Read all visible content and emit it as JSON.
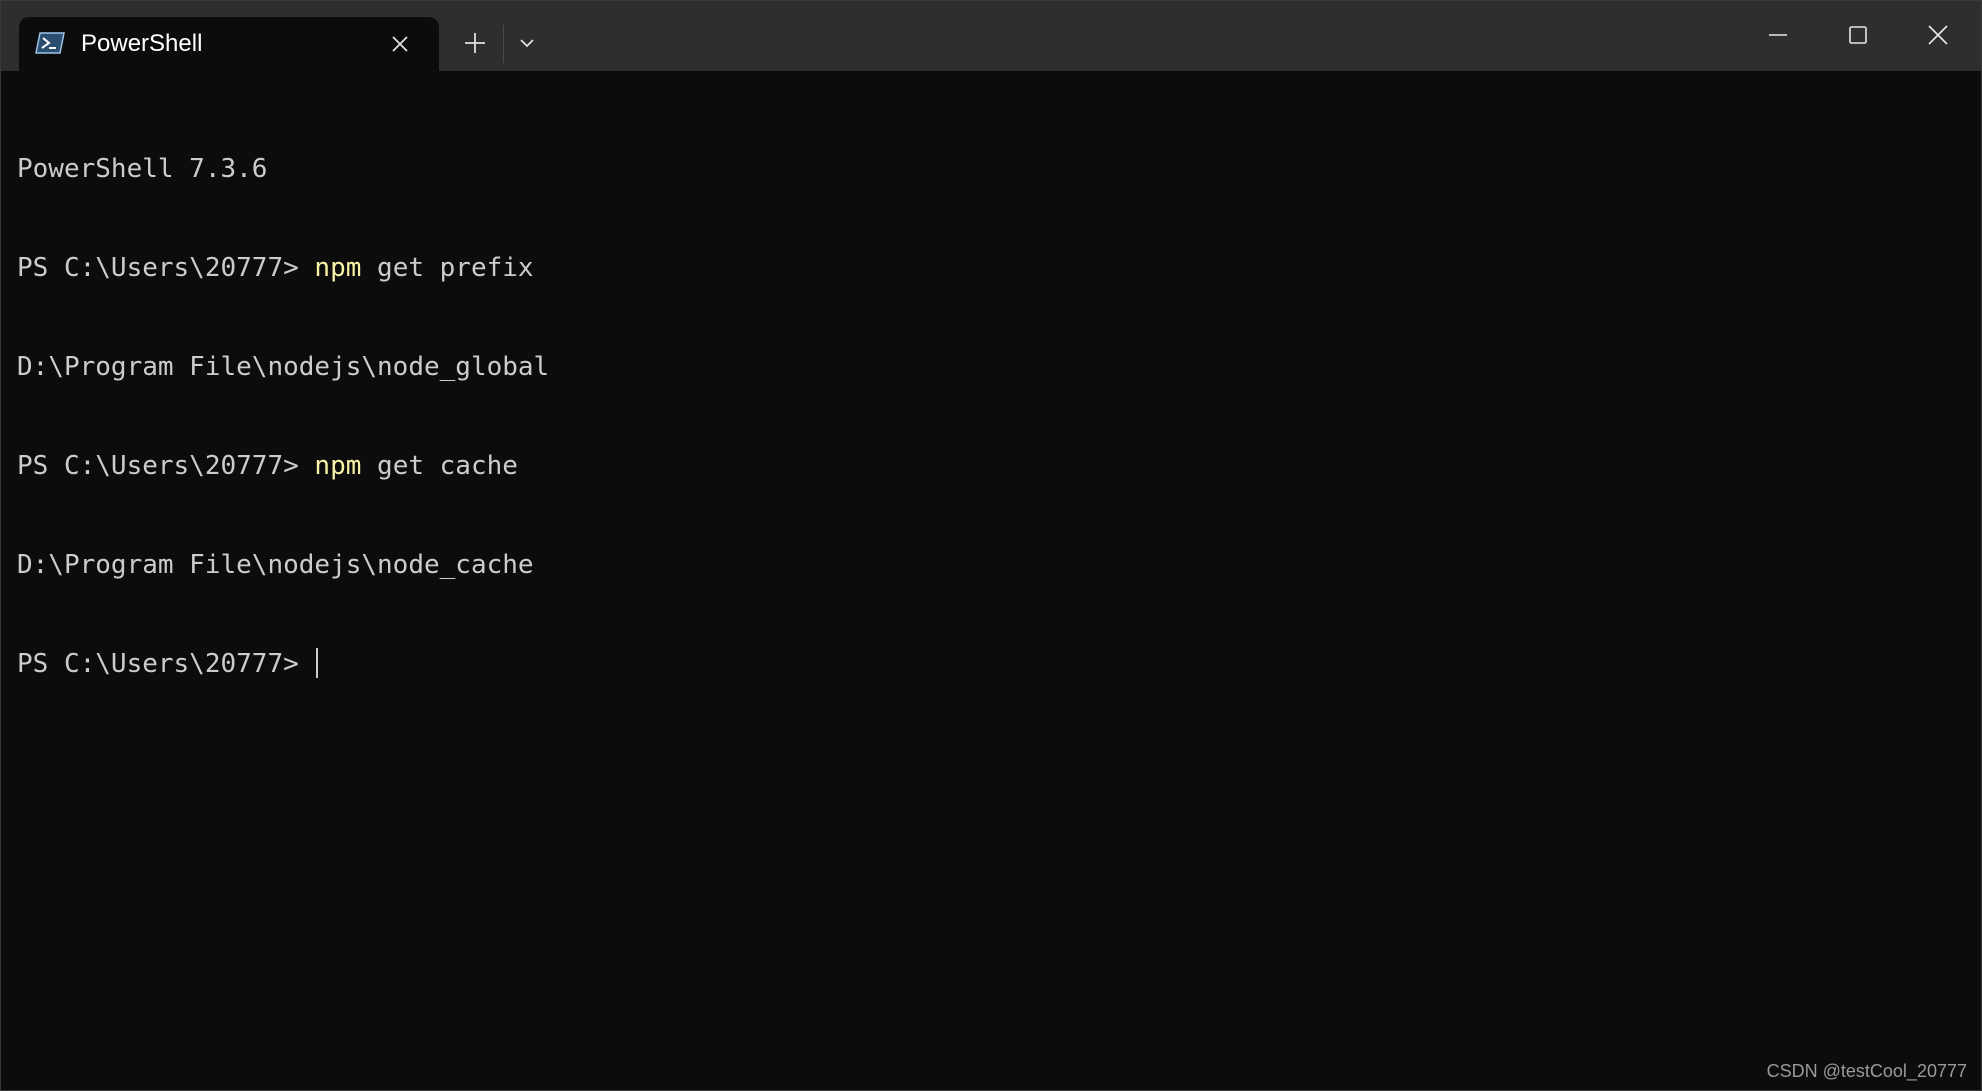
{
  "window": {
    "tab_title": "PowerShell",
    "tab_icon": "powershell-icon",
    "controls": {
      "new_tab_icon": "plus-icon",
      "dropdown_icon": "chevron-down-icon",
      "minimize_icon": "minimize-icon",
      "maximize_icon": "maximize-icon",
      "close_icon": "close-icon"
    }
  },
  "terminal": {
    "banner": "PowerShell 7.3.6",
    "lines": [
      {
        "prompt": "PS C:\\Users\\20777> ",
        "command": "npm",
        "args": " get prefix"
      },
      {
        "output": "D:\\Program File\\nodejs\\node_global"
      },
      {
        "prompt": "PS C:\\Users\\20777> ",
        "command": "npm",
        "args": " get cache"
      },
      {
        "output": "D:\\Program File\\nodejs\\node_cache"
      },
      {
        "prompt": "PS C:\\Users\\20777> "
      }
    ]
  },
  "watermark": "CSDN @testCool_20777",
  "colors": {
    "background": "#0c0c0c",
    "titlebar": "#2e2e2e",
    "text": "#cccccc",
    "command_highlight": "#f9f1a5"
  }
}
